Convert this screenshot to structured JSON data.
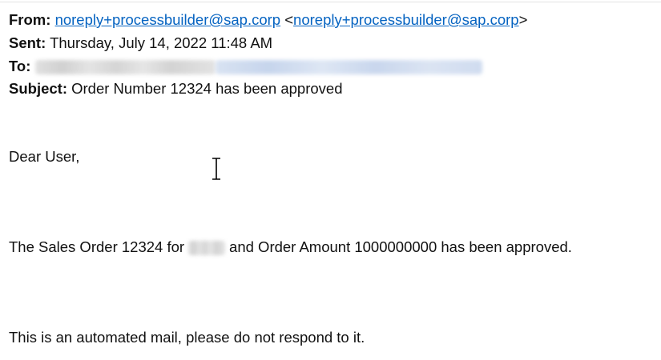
{
  "email": {
    "from": {
      "label": "From:",
      "sender_name": "noreply+processbuilder@sap.corp",
      "open_angle": "<",
      "sender_address": "noreply+processbuilder@sap.corp",
      "close_angle": ">"
    },
    "sent": {
      "label": "Sent:",
      "value": "Thursday, July 14, 2022 11:48 AM"
    },
    "to": {
      "label": "To:"
    },
    "subject": {
      "label": "Subject:",
      "value": "Order Number 12324 has been approved"
    },
    "body": {
      "greeting": "Dear User,",
      "approval_prefix": "The Sales Order 12324 for",
      "approval_suffix": "and Order Amount 1000000000 has been approved.",
      "footer": "This is an automated mail, please do not respond to it."
    }
  },
  "colors": {
    "link": "#0563c1",
    "text": "#111111"
  },
  "icons": {
    "cursor": "text-cursor-icon"
  }
}
